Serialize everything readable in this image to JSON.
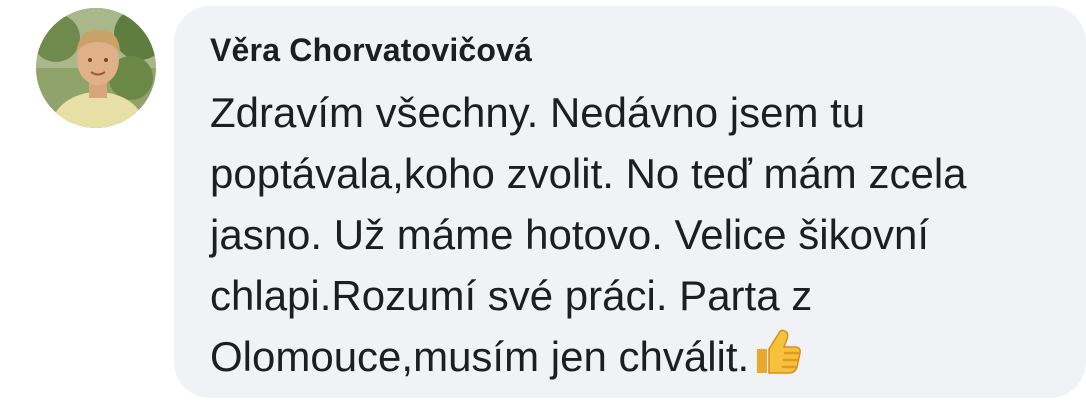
{
  "comment": {
    "author": "Věra Chorvatovičová",
    "lines": [
      "Zdravím všechny. Nedávno jsem tu",
      "poptávala,koho zvolit. No teď mám zcela",
      "jasno. Už máme hotovo. Velice šikovní",
      "chlapi.Rozumí své práci. Parta z",
      "Olomouce,musím jen chválit."
    ],
    "trailing_emoji": "thumbs-up-emoji"
  },
  "colors": {
    "bubble_background": "#f0f2f5",
    "text": "#1c1e21",
    "emoji_yellow": "#f7c23b"
  }
}
